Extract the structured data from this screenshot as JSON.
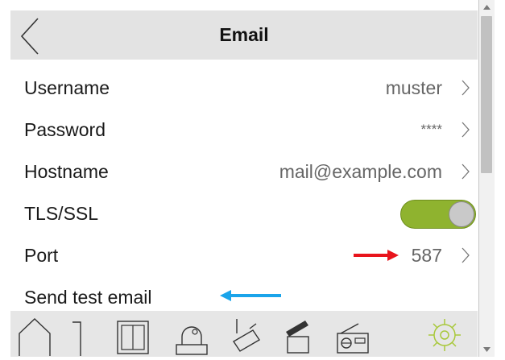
{
  "header": {
    "title": "Email"
  },
  "settings": [
    {
      "label": "Username",
      "value": "muster"
    },
    {
      "label": "Password",
      "value": "****"
    },
    {
      "label": "Hostname",
      "value": "mail@example.com"
    },
    {
      "label": "TLS/SSL",
      "toggle_on": true
    },
    {
      "label": "Port",
      "value": "587"
    },
    {
      "label": "Send test email"
    }
  ],
  "annotations": {
    "red_arrow_color": "#e8141c",
    "blue_arrow_color": "#1aa4ea"
  },
  "tabbar": {
    "items": [
      {
        "icon": "home-icon"
      },
      {
        "icon": "bracket-icon"
      },
      {
        "icon": "window-icon"
      },
      {
        "icon": "camera-icon"
      },
      {
        "icon": "security-camera-icon"
      },
      {
        "icon": "clapperboard-icon"
      },
      {
        "icon": "radio-icon"
      },
      {
        "icon": "gear-icon",
        "active": true
      }
    ],
    "active_color": "#a8c83a"
  }
}
